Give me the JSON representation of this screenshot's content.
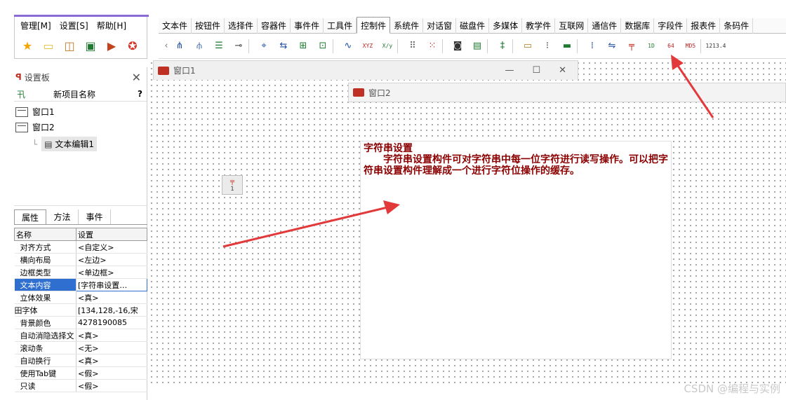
{
  "left_menu": {
    "items": [
      "管理[M]",
      "设置[S]",
      "帮助[H]"
    ],
    "toolbar_icons": [
      "star-icon",
      "folder-icon",
      "open-icon",
      "save-icon",
      "run-icon",
      "stop-icon"
    ]
  },
  "tabs": [
    "文本件",
    "按钮件",
    "选择件",
    "容器件",
    "事件件",
    "工具件",
    "控制件",
    "系统件",
    "对话窗",
    "磁盘件",
    "多媒体",
    "教学件",
    "互联网",
    "通信件",
    "数据库",
    "字段件",
    "报表件",
    "条码件"
  ],
  "active_tab": "控制件",
  "toolbar": {
    "label_xyz": "XYZ",
    "label_xy": "X/y",
    "label_1d": "1D",
    "label_64": "64",
    "label_md5": "MD5",
    "label_1234": "1213.4"
  },
  "panel": {
    "title": "设置板",
    "project_name_label": "新项目名称",
    "help": "?",
    "tree": [
      "窗口1",
      "窗口2",
      "文本编辑1"
    ],
    "tabs": [
      "属性",
      "方法",
      "事件"
    ],
    "table_header": [
      "名称",
      "设置"
    ],
    "properties": [
      {
        "name": "对齐方式",
        "value": "<自定义>"
      },
      {
        "name": "横向布局",
        "value": "<左边>"
      },
      {
        "name": "边框类型",
        "value": "<单边框>"
      },
      {
        "name": "文本内容",
        "value": "[字符串设置…"
      },
      {
        "name": "立体效果",
        "value": "<真>"
      },
      {
        "name": "田字体",
        "value": "[134,128,-16,宋"
      },
      {
        "name": "背景颜色",
        "value": "4278190085"
      },
      {
        "name": "自动消隐选择文",
        "value": "<真>"
      },
      {
        "name": "滚动条",
        "value": "<无>"
      },
      {
        "name": "自动换行",
        "value": "<真>"
      },
      {
        "name": "使用Tab键",
        "value": "<假>"
      },
      {
        "name": "只读",
        "value": "<假>"
      }
    ]
  },
  "window1": {
    "title": "窗口1"
  },
  "window2": {
    "title": "窗口2"
  },
  "text_editor": {
    "title": "字符串设置",
    "body": "字符串设置构件可对字符串中每一位字符进行读写操作。可以把字符串设置构件理解成一个进行字符位操作的缓存。"
  },
  "component_icon_label": "1",
  "watermark": "CSDN @编程与实例",
  "colors": {
    "accent": "#e2393b",
    "text_red": "#8b0000",
    "selection": "#2f6fcf"
  }
}
